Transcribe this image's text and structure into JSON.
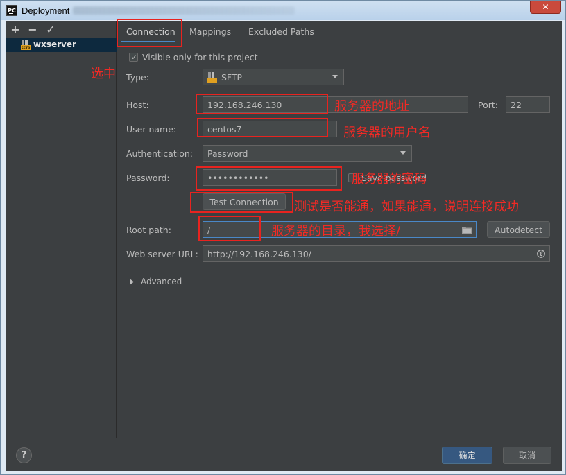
{
  "window": {
    "title": "Deployment",
    "close_glyph": "✕",
    "app_icon_text": "PC"
  },
  "left_toolbar": {
    "add": "+",
    "remove": "−",
    "apply": "✓"
  },
  "server": {
    "name": "wxserver",
    "icon": "sftp-server-icon"
  },
  "tabs": [
    "Connection",
    "Mappings",
    "Excluded Paths"
  ],
  "connection": {
    "visible_only_label": "Visible only for this project",
    "type_label": "Type:",
    "type_value": "SFTP",
    "host_label": "Host:",
    "host_value": "192.168.246.130",
    "port_label": "Port:",
    "port_value": "22",
    "username_label": "User name:",
    "username_value": "centos7",
    "auth_label": "Authentication:",
    "auth_value": "Password",
    "password_label": "Password:",
    "password_value": "••••••••••••",
    "save_password_label": "Save password",
    "test_button": "Test Connection",
    "root_label": "Root path:",
    "root_value": "/",
    "autodetect_button": "Autodetect",
    "web_url_label": "Web server URL:",
    "web_url_value": "http://192.168.246.130/",
    "advanced_label": "Advanced"
  },
  "footer": {
    "help": "?",
    "ok": "确定",
    "cancel": "取消"
  },
  "annotations": {
    "selected": "选中",
    "host": "服务器的地址",
    "username": "服务器的用户名",
    "password": "服务器的密码",
    "test": "测试是否能通，如果能通，说明连接成功",
    "root": "服务器的目录，我选择/"
  },
  "colors": {
    "annotation": "#f22a25",
    "accent": "#4a88c7",
    "ok_button": "#365880"
  }
}
